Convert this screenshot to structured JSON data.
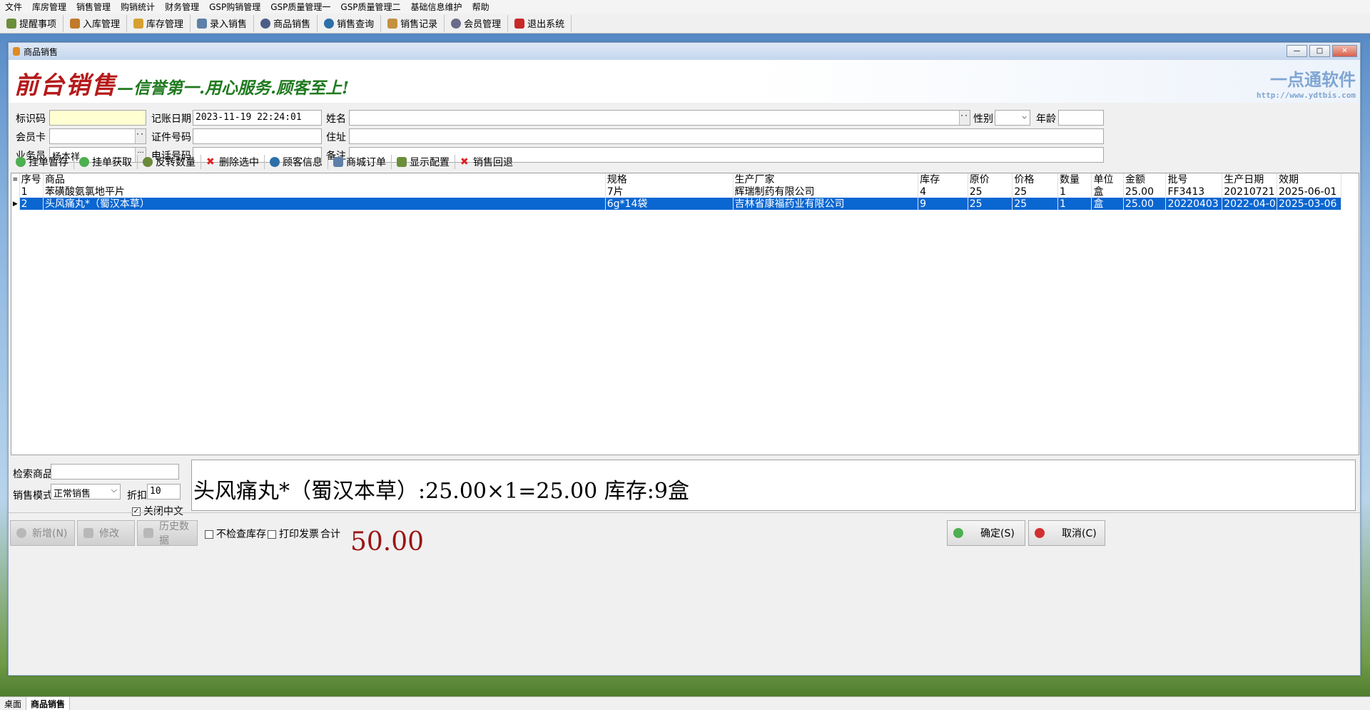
{
  "menu": [
    "文件",
    "库房管理",
    "销售管理",
    "购销统计",
    "财务管理",
    "GSP购销管理",
    "GSP质量管理一",
    "GSP质量管理二",
    "基础信息维护",
    "帮助"
  ],
  "toolbar": [
    "提醒事项",
    "入库管理",
    "库存管理",
    "录入销售",
    "商品销售",
    "销售查询",
    "销售记录",
    "会员管理",
    "退出系统"
  ],
  "window": {
    "title": "商品销售",
    "logo": "前台销售",
    "slogan": "—信誉第一.用心服务.顾客至上!",
    "brand_name": "一点通软件",
    "brand_url": "http://www.ydtbis.com"
  },
  "form": {
    "id_label": "标识码",
    "id_value": "",
    "date_label": "记账日期",
    "date_value": "2023-11-19 22:24:01",
    "name_label": "姓名",
    "name_value": "",
    "gender_label": "性别",
    "gender_value": "",
    "age_label": "年龄",
    "age_value": "",
    "card_label": "会员卡",
    "card_value": "",
    "cert_label": "证件号码",
    "cert_value": "",
    "addr_label": "住址",
    "addr_value": "",
    "staff_label": "业务员",
    "staff_value": "杨本祥",
    "phone_label": "电话号码",
    "phone_value": "",
    "note_label": "备注",
    "note_value": ""
  },
  "actions": [
    "挂单暂存",
    "挂单获取",
    "反转数量",
    "删除选中",
    "顾客信息",
    "商城订单",
    "显示配置",
    "销售回退"
  ],
  "grid": {
    "headers": [
      "序号",
      "商品",
      "规格",
      "生产厂家",
      "库存",
      "原价",
      "价格",
      "数量",
      "单位",
      "金额",
      "批号",
      "生产日期",
      "效期"
    ],
    "rows": [
      [
        "1",
        "苯磺酸氨氯地平片",
        "7片",
        "辉瑞制药有限公司",
        "4",
        "25",
        "25",
        "1",
        "盒",
        "25.00",
        "FF3413",
        "20210721",
        "2025-06-01"
      ],
      [
        "2",
        "头风痛丸*（蜀汉本草）",
        "6g*14袋",
        "吉林省康福药业有限公司",
        "9",
        "25",
        "25",
        "1",
        "盒",
        "25.00",
        "20220403",
        "2022-04-0",
        "2025-03-06"
      ]
    ]
  },
  "bottom": {
    "search_label": "检索商品",
    "search_value": "",
    "mode_label": "销售模式",
    "mode_value": "正常销售",
    "discount_label": "折扣",
    "discount_value": "10",
    "close_cn_label": "关闭中文",
    "info_text": "头风痛丸*（蜀汉本草）:25.00×1=25.00 库存:9盒"
  },
  "footer": {
    "new_label": "新增(N)",
    "edit_label": "修改",
    "history_label": "历史数据",
    "nocheck_label": "不检查库存",
    "print_label": "打印发票",
    "total_label": "合计",
    "total_value": "50.00",
    "ok_label": "确定(S)",
    "cancel_label": "取消(C)"
  },
  "status_tabs": [
    "桌面",
    "商品销售"
  ]
}
